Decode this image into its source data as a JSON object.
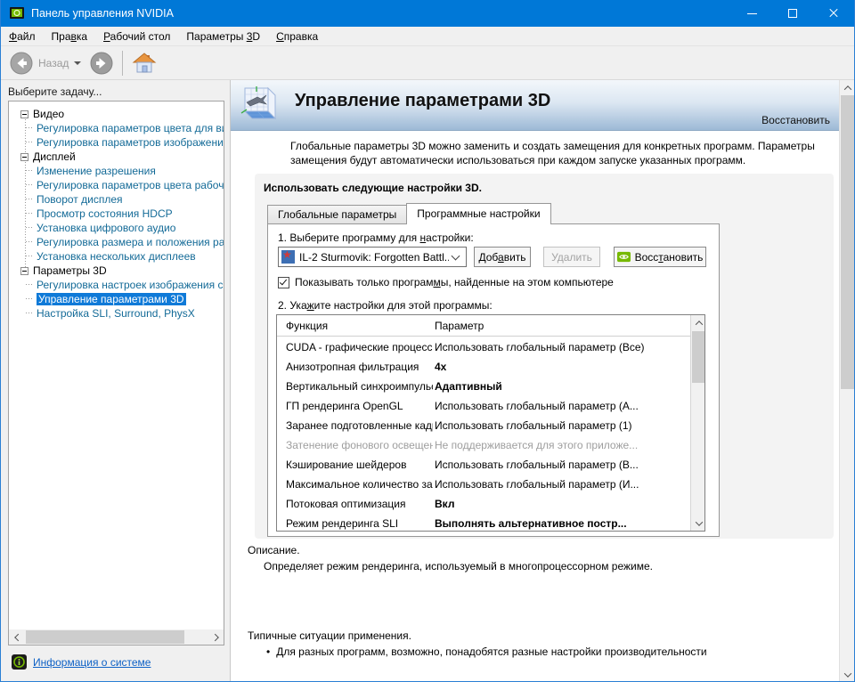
{
  "titlebar": {
    "title": "Панель управления NVIDIA"
  },
  "menu": {
    "items": [
      {
        "pre": "",
        "accel": "Ф",
        "post": "айл"
      },
      {
        "pre": "Пра",
        "accel": "в",
        "post": "ка"
      },
      {
        "pre": "",
        "accel": "Р",
        "post": "абочий стол"
      },
      {
        "pre": "Параметры ",
        "accel": "3",
        "post": "D"
      },
      {
        "pre": "",
        "accel": "С",
        "post": "правка"
      }
    ]
  },
  "toolbar": {
    "back_label": "Назад"
  },
  "sidebar": {
    "header": "Выберите задачу...",
    "tree": [
      {
        "label": "Видео",
        "items": [
          {
            "label": "Регулировка параметров цвета для видео"
          },
          {
            "label": "Регулировка параметров изображения для видео"
          }
        ]
      },
      {
        "label": "Дисплей",
        "items": [
          {
            "label": "Изменение разрешения"
          },
          {
            "label": "Регулировка параметров цвета рабочего стола"
          },
          {
            "label": "Поворот дисплея"
          },
          {
            "label": "Просмотр состояния HDCP"
          },
          {
            "label": "Установка цифрового аудио"
          },
          {
            "label": "Регулировка размера и положения рабочего стола"
          },
          {
            "label": "Установка нескольких дисплеев"
          }
        ]
      },
      {
        "label": "Параметры 3D",
        "items": [
          {
            "label": "Регулировка настроек изображения с просмотром"
          },
          {
            "label": "Управление параметрами 3D",
            "selected": true
          },
          {
            "label": "Настройка SLI, Surround, PhysX"
          }
        ]
      }
    ],
    "footer_link": "Информация о системе"
  },
  "main": {
    "title": "Управление параметрами 3D",
    "restore_top": "Восстановить",
    "intro": "Глобальные параметры 3D можно заменить и создать замещения для конкретных программ. Параметры замещения будут автоматически использоваться при каждом запуске указанных программ.",
    "section_title": "Использовать следующие настройки 3D.",
    "tabs": [
      {
        "label": "Глобальные параметры"
      },
      {
        "label": "Программные настройки"
      }
    ],
    "step1": {
      "pre": "1. Выберите программу для ",
      "accel": "н",
      "post": "астройки:"
    },
    "combo": {
      "value": "IL-2 Sturmovik: Forgotten Battl..."
    },
    "buttons": {
      "add": {
        "pre": "Доб",
        "accel": "а",
        "post": "вить"
      },
      "remove": "Удалить",
      "restore": {
        "pre": "Восс",
        "accel": "т",
        "post": "ановить"
      }
    },
    "checkbox": {
      "pre": "Показывать только програм",
      "accel": "м",
      "post": "ы, найденные на этом компьютере",
      "checked": true
    },
    "step2": {
      "pre": "2. Ука",
      "accel": "ж",
      "post": "ите настройки для этой программы:"
    },
    "table": {
      "headers": {
        "func": "Функция",
        "param": "Параметр"
      },
      "rows": [
        {
          "func": "CUDA - графические процессоры",
          "param": "Использовать глобальный параметр (Все)",
          "style": "normal"
        },
        {
          "func": "Анизотропная фильтрация",
          "param": "4x",
          "style": "bold"
        },
        {
          "func": "Вертикальный синхроимпульс",
          "param": "Адаптивный",
          "style": "bold"
        },
        {
          "func": "ГП рендеринга OpenGL",
          "param": "Использовать глобальный параметр (А...",
          "style": "normal"
        },
        {
          "func": "Заранее подготовленные кадры вирту...",
          "param": "Использовать глобальный параметр (1)",
          "style": "normal"
        },
        {
          "func": "Затенение фонового освещения",
          "param": "Не поддерживается для этого приложе...",
          "style": "disabled"
        },
        {
          "func": "Кэширование шейдеров",
          "param": "Использовать глобальный параметр (В...",
          "style": "normal"
        },
        {
          "func": "Максимальное количество заранее под...",
          "param": "Использовать глобальный параметр (И...",
          "style": "normal"
        },
        {
          "func": "Потоковая оптимизация",
          "param": "Вкл",
          "style": "bold"
        },
        {
          "func": "Режим рендеринга SLI",
          "param": "Выполнять альтернативное постр...",
          "style": "bold"
        }
      ]
    },
    "description": {
      "heading": "Описание.",
      "text": "Определяет режим рендеринга, используемый в многопроцессорном режиме."
    },
    "usage": {
      "heading": "Типичные ситуации применения.",
      "bullet": "Для разных программ, возможно, понадобятся разные настройки производительности"
    }
  },
  "colors": {
    "titlebar": "#0078d7",
    "selection": "#0f7ad8",
    "tree_link": "#136a97",
    "nvidia_green": "#76b900",
    "header_gradient_bottom": "#9db9d6"
  }
}
